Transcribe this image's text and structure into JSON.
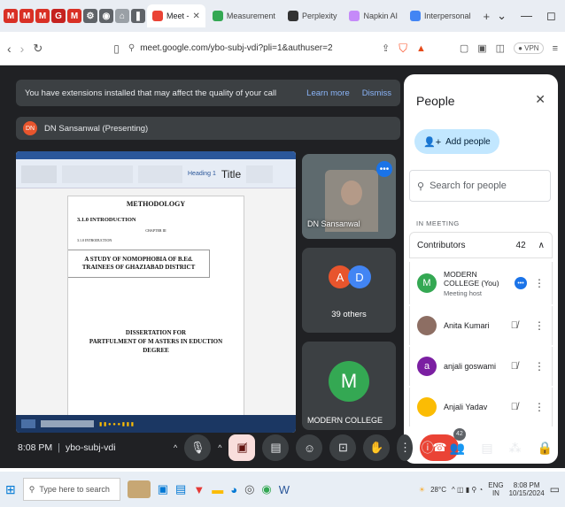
{
  "browser": {
    "tabs": [
      {
        "label": "Meet - ",
        "active": true
      },
      {
        "label": "Measurement"
      },
      {
        "label": "Perplexity"
      },
      {
        "label": "Napkin AI"
      },
      {
        "label": "Interpersonal"
      }
    ],
    "url": "meet.google.com/ybo-subj-vdi?pli=1&authuser=2",
    "vpn_label": "VPN"
  },
  "meet": {
    "banner_text": "You have extensions installed that may affect the quality of your call",
    "banner_learn": "Learn more",
    "banner_dismiss": "Dismiss",
    "presenter_initials": "DN",
    "presenter_text": "DN Sansanwal (Presenting)",
    "tile_dn_label": "DN Sansanwal",
    "others_label": "39 others",
    "others_a": "A",
    "others_d": "D",
    "modern_initial": "M",
    "modern_label": "MODERN COLLEGE",
    "time": "8:08 PM",
    "separator": "|",
    "meeting_code": "ybo-subj-vdi",
    "participant_count": "42"
  },
  "document": {
    "heading_style": "Heading 1",
    "title_style": "Title",
    "methodology": "METHODOLOGY",
    "section": "3.1.0 INTRODUCTION",
    "chapter": "CHAPTER III",
    "intro": "3.1.0 INTRODUCTION",
    "study_title": "A STUDY OF NOMOPHOBIA OF B.Ed. TRAINEES OF GHAZIABAD DISTRICT",
    "dissertation": "DISSERTATION FOR",
    "fulfilment": "PARTFULMENT OF M ASTERS IN EDUCTION",
    "degree": "DEGREE"
  },
  "people_panel": {
    "title": "People",
    "add_people": "Add people",
    "search_placeholder": "Search for people",
    "in_meeting": "IN MEETING",
    "contributors_label": "Contributors",
    "contributors_count": "42",
    "people": [
      {
        "name": "MODERN COLLEGE (You)",
        "sub": "Meeting host",
        "initial": "M",
        "color": "#34a853"
      },
      {
        "name": "Anita Kumari",
        "sub": "",
        "initial": "",
        "color": "#8d6e63"
      },
      {
        "name": "anjali goswami",
        "sub": "",
        "initial": "a",
        "color": "#7b1fa2"
      },
      {
        "name": "Anjali Yadav",
        "sub": "",
        "initial": "",
        "color": "#fbbc04"
      }
    ]
  },
  "taskbar": {
    "search_placeholder": "Type here to search",
    "temperature": "28°C",
    "language_top": "ENG",
    "language_bottom": "IN",
    "clock_time": "8:08 PM",
    "clock_date": "10/15/2024"
  },
  "colors": {
    "meet_bg": "#202124",
    "end_call": "#ea4335",
    "accent_blue": "#1a73e8"
  }
}
